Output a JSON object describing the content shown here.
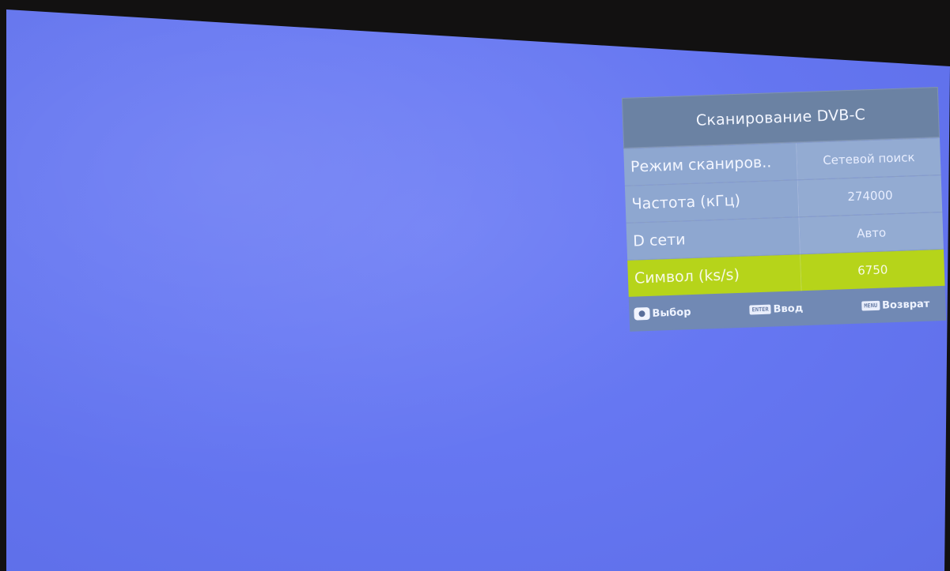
{
  "menu": {
    "title": "Сканирование DVB-C",
    "rows": [
      {
        "label": "Режим сканиров..",
        "value": "Сетевой поиск",
        "selected": false
      },
      {
        "label": "Частота (кГц)",
        "value": "274000",
        "selected": false
      },
      {
        "label": "D сети",
        "value": "Авто",
        "selected": false
      },
      {
        "label": "Символ (ks/s)",
        "value": "6750",
        "selected": true
      }
    ],
    "footer": {
      "select": {
        "icon": "dpad-icon",
        "label": "Выбор"
      },
      "enter": {
        "key": "ENTER",
        "label": "Ввод"
      },
      "back": {
        "key": "MENU",
        "label": "Возврат"
      }
    }
  },
  "colors": {
    "screen": "#6677f2",
    "menu_title": "#6b82a3",
    "menu_row": "#8ea7d0",
    "selected_row": "#b6d41a"
  }
}
